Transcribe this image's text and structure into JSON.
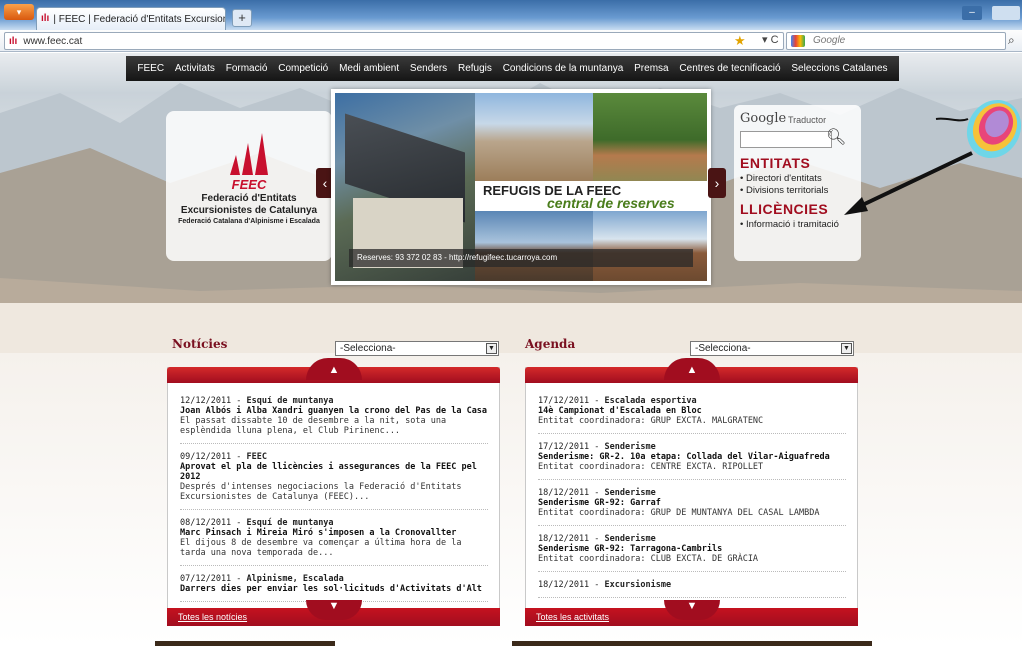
{
  "browser": {
    "tab_title": "| FEEC | Federació d'Entitats Excursionist...",
    "new_tab": "+",
    "url": "www.feec.cat",
    "search_placeholder": "Google"
  },
  "menu": [
    "FEEC",
    "Activitats",
    "Formació",
    "Competició",
    "Medi ambient",
    "Senders",
    "Refugis",
    "Condicions de la muntanya",
    "Premsa",
    "Centres de tecnificació",
    "Seleccions Catalanes"
  ],
  "logo": {
    "acronym": "FEEC",
    "line1": "Federació d'Entitats",
    "line2": "Excursionistes de Catalunya",
    "line3": "Federació Catalana d'Alpinisme i Escalada"
  },
  "slider": {
    "title": "REFUGIS DE LA FEEC",
    "subtitle": "central de reserves",
    "caption": "Reserves: 93 372 02 83 - http://refugifeec.tucarroya.com"
  },
  "sidebar": {
    "google_brand": "Google",
    "google_tool": "Traductor",
    "entitats_heading": "ENTITATS",
    "entitats_links": [
      "Directori d'entitats",
      "Divisions territorials"
    ],
    "llicencies_heading": "LLICÈNCIES",
    "llicencies_links": [
      "Informació i tramitació"
    ]
  },
  "noticies": {
    "heading": "Notícies",
    "select_value": "-Selecciona-",
    "footer_link": "Totes les notícies",
    "items": [
      {
        "date": "12/12/2011",
        "category": "Esquí de muntanya",
        "title": "Joan Albós i Alba Xandri guanyen la crono del Pas de la Casa",
        "desc": "El passat dissabte 10 de desembre a la nit, sota una esplèndida lluna plena, el Club Pirinenc..."
      },
      {
        "date": "09/12/2011",
        "category": "FEEC",
        "title": "Aprovat el pla de llicències i assegurances de la FEEC pel 2012",
        "desc": "Després d'intenses negociacions la Federació d'Entitats Excursionistes de Catalunya (FEEC)..."
      },
      {
        "date": "08/12/2011",
        "category": "Esquí de muntanya",
        "title": "Marc Pinsach i Mireia Miró s'imposen a la Cronovallter",
        "desc": "El dijous 8 de desembre va començar a última hora de la tarda una nova temporada de..."
      },
      {
        "date": "07/12/2011",
        "category": "Alpinisme, Escalada",
        "title": "Darrers dies per enviar les sol·licituds d'Activitats d'Alt",
        "desc": ""
      }
    ]
  },
  "agenda": {
    "heading": "Agenda",
    "select_value": "-Selecciona-",
    "footer_link": "Totes les activitats",
    "items": [
      {
        "date": "17/12/2011",
        "category": "Escalada esportiva",
        "title": "14è Campionat d'Escalada en Bloc",
        "desc": "Entitat coordinadora: GRUP EXCTA. MALGRATENC"
      },
      {
        "date": "17/12/2011",
        "category": "Senderisme",
        "title": "Senderisme: GR-2. 10a etapa: Collada del Vilar-Aiguafreda",
        "desc": "Entitat coordinadora: CENTRE EXCTA. RIPOLLET"
      },
      {
        "date": "18/12/2011",
        "category": "Senderisme",
        "title": "Senderisme GR-92: Garraf",
        "desc": "Entitat coordinadora: GRUP DE MUNTANYA DEL CASAL LAMBDA"
      },
      {
        "date": "18/12/2011",
        "category": "Senderisme",
        "title": "Senderisme GR-92: Tarragona-Cambrils",
        "desc": "Entitat coordinadora: CLUB EXCTA. DE GRÀCIA"
      },
      {
        "date": "18/12/2011",
        "category": "Excursionisme",
        "title": "",
        "desc": ""
      }
    ]
  }
}
